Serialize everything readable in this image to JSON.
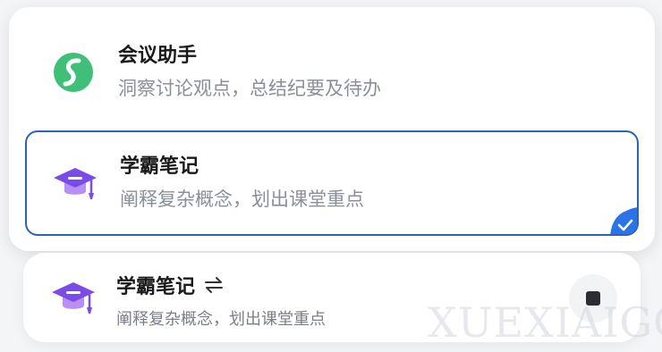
{
  "menu": {
    "options": [
      {
        "title": "会议助手",
        "description": "洞察讨论观点，总结纪要及待办",
        "icon": "meeting-assistant-logo-icon",
        "selected": false
      },
      {
        "title": "学霸笔记",
        "description": "阐释复杂概念，划出课堂重点",
        "icon": "graduation-cap-icon",
        "selected": true
      }
    ]
  },
  "current": {
    "title": "学霸笔记",
    "description": "阐释复杂概念，划出课堂重点",
    "switch_icon": "swap-arrows-icon",
    "stop_icon": "stop-icon"
  },
  "watermark": "XUEXIAIGC",
  "colors": {
    "accent": "#2b63b5",
    "check_badge": "#2a73e8",
    "green_logo": "#3fbf78",
    "cap_purple": "#7a4be8"
  }
}
